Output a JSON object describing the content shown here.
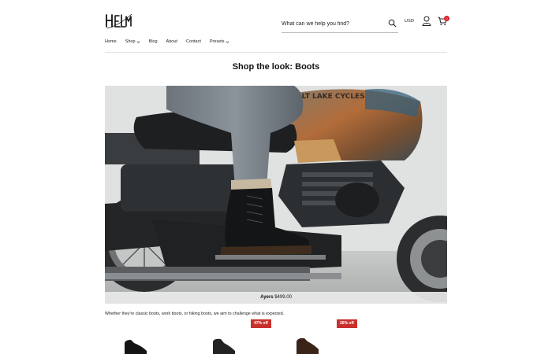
{
  "header": {
    "logo_text": "HELM",
    "search_placeholder": "What can we help you find?",
    "currency": "USD",
    "cart_count": "0"
  },
  "nav": {
    "items": [
      {
        "label": "Home",
        "has_dropdown": false
      },
      {
        "label": "Shop",
        "has_dropdown": true
      },
      {
        "label": "Blog",
        "has_dropdown": false
      },
      {
        "label": "About",
        "has_dropdown": false
      },
      {
        "label": "Contact",
        "has_dropdown": false
      },
      {
        "label": "Presets",
        "has_dropdown": true
      }
    ]
  },
  "page": {
    "title_prefix": "Shop the look:",
    "title_bold": "Boots",
    "description": "Whether they're classic boots, work boots, or hiking boots, we aim to challenge what is expected."
  },
  "hero": {
    "tank_text": "SALT LAKE CYCLES",
    "caption_name": "Ayers",
    "caption_price": "$499.00"
  },
  "products": {
    "badges": [
      "47% off",
      "26% off"
    ]
  },
  "colors": {
    "accent": "#c9302c",
    "cart_badge": "#d61f26"
  }
}
